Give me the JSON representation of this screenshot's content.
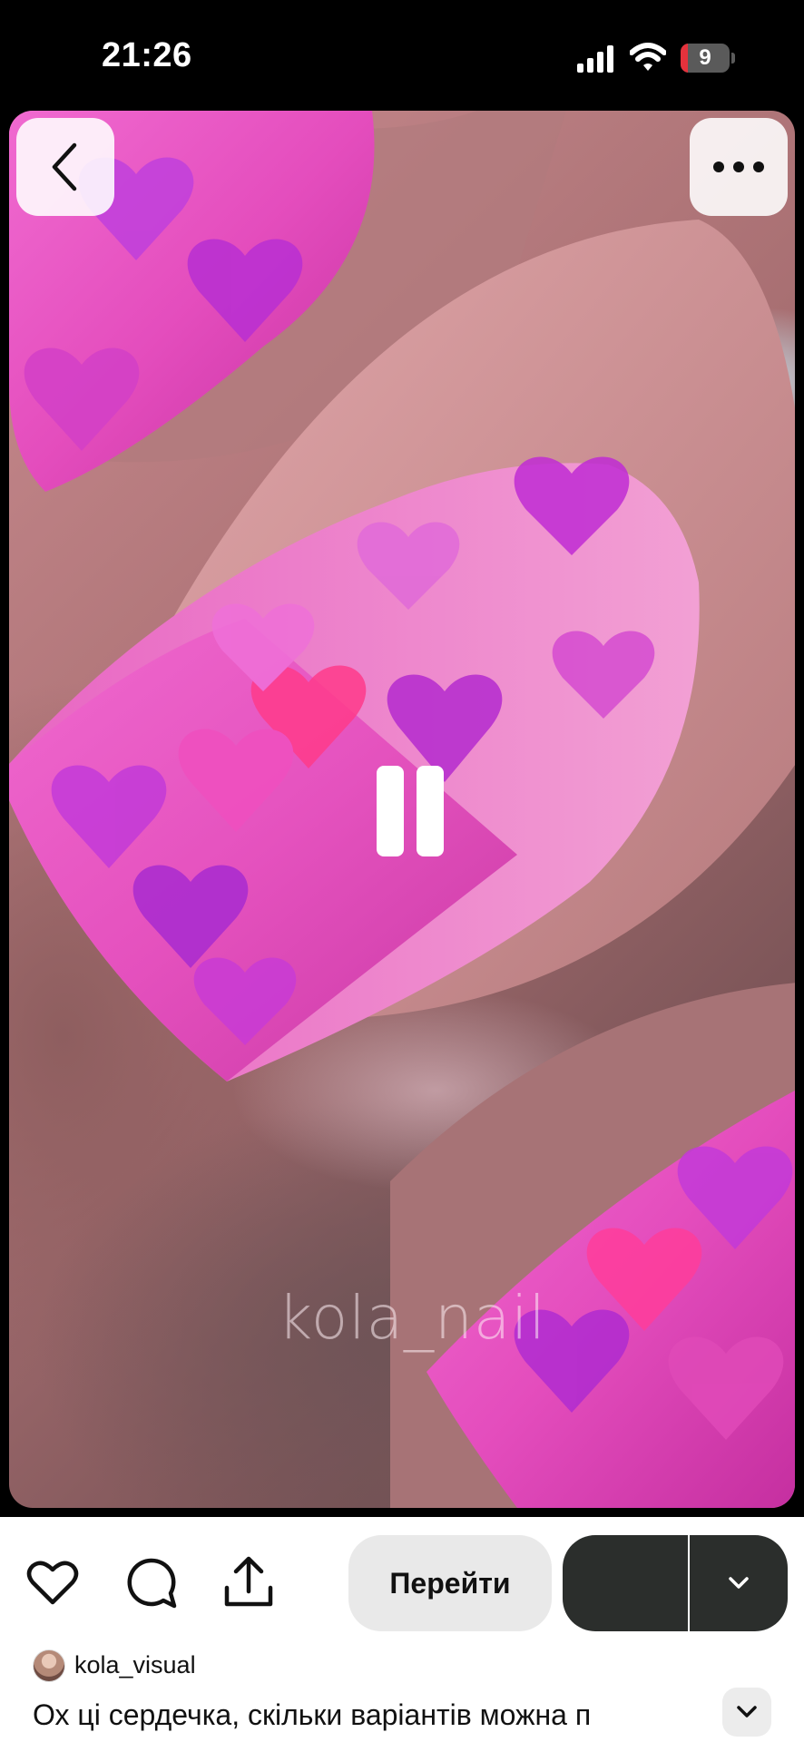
{
  "status_bar": {
    "time": "21:26",
    "battery_level": "9",
    "battery_fraction": 0.09,
    "icons": [
      "signal-icon",
      "wifi-icon",
      "battery-icon"
    ]
  },
  "media": {
    "watermark": "kola_nail",
    "state_icon": "pause-icon",
    "top_left_icon": "chevron-left-icon",
    "top_right_icon": "more-horizontal-icon"
  },
  "actions": {
    "icons": [
      "heart-icon",
      "comment-icon",
      "share-icon"
    ],
    "visit_label": "Перейти",
    "dropdown_icon": "chevron-down-icon"
  },
  "pin": {
    "author": "kola_visual",
    "description": "Ох ці сердечка, скільки варіантів можна п"
  },
  "colors": {
    "save_button": "#2b2e2c",
    "visit_button": "#e9e9e9",
    "battery_accent": "#e5323c"
  }
}
